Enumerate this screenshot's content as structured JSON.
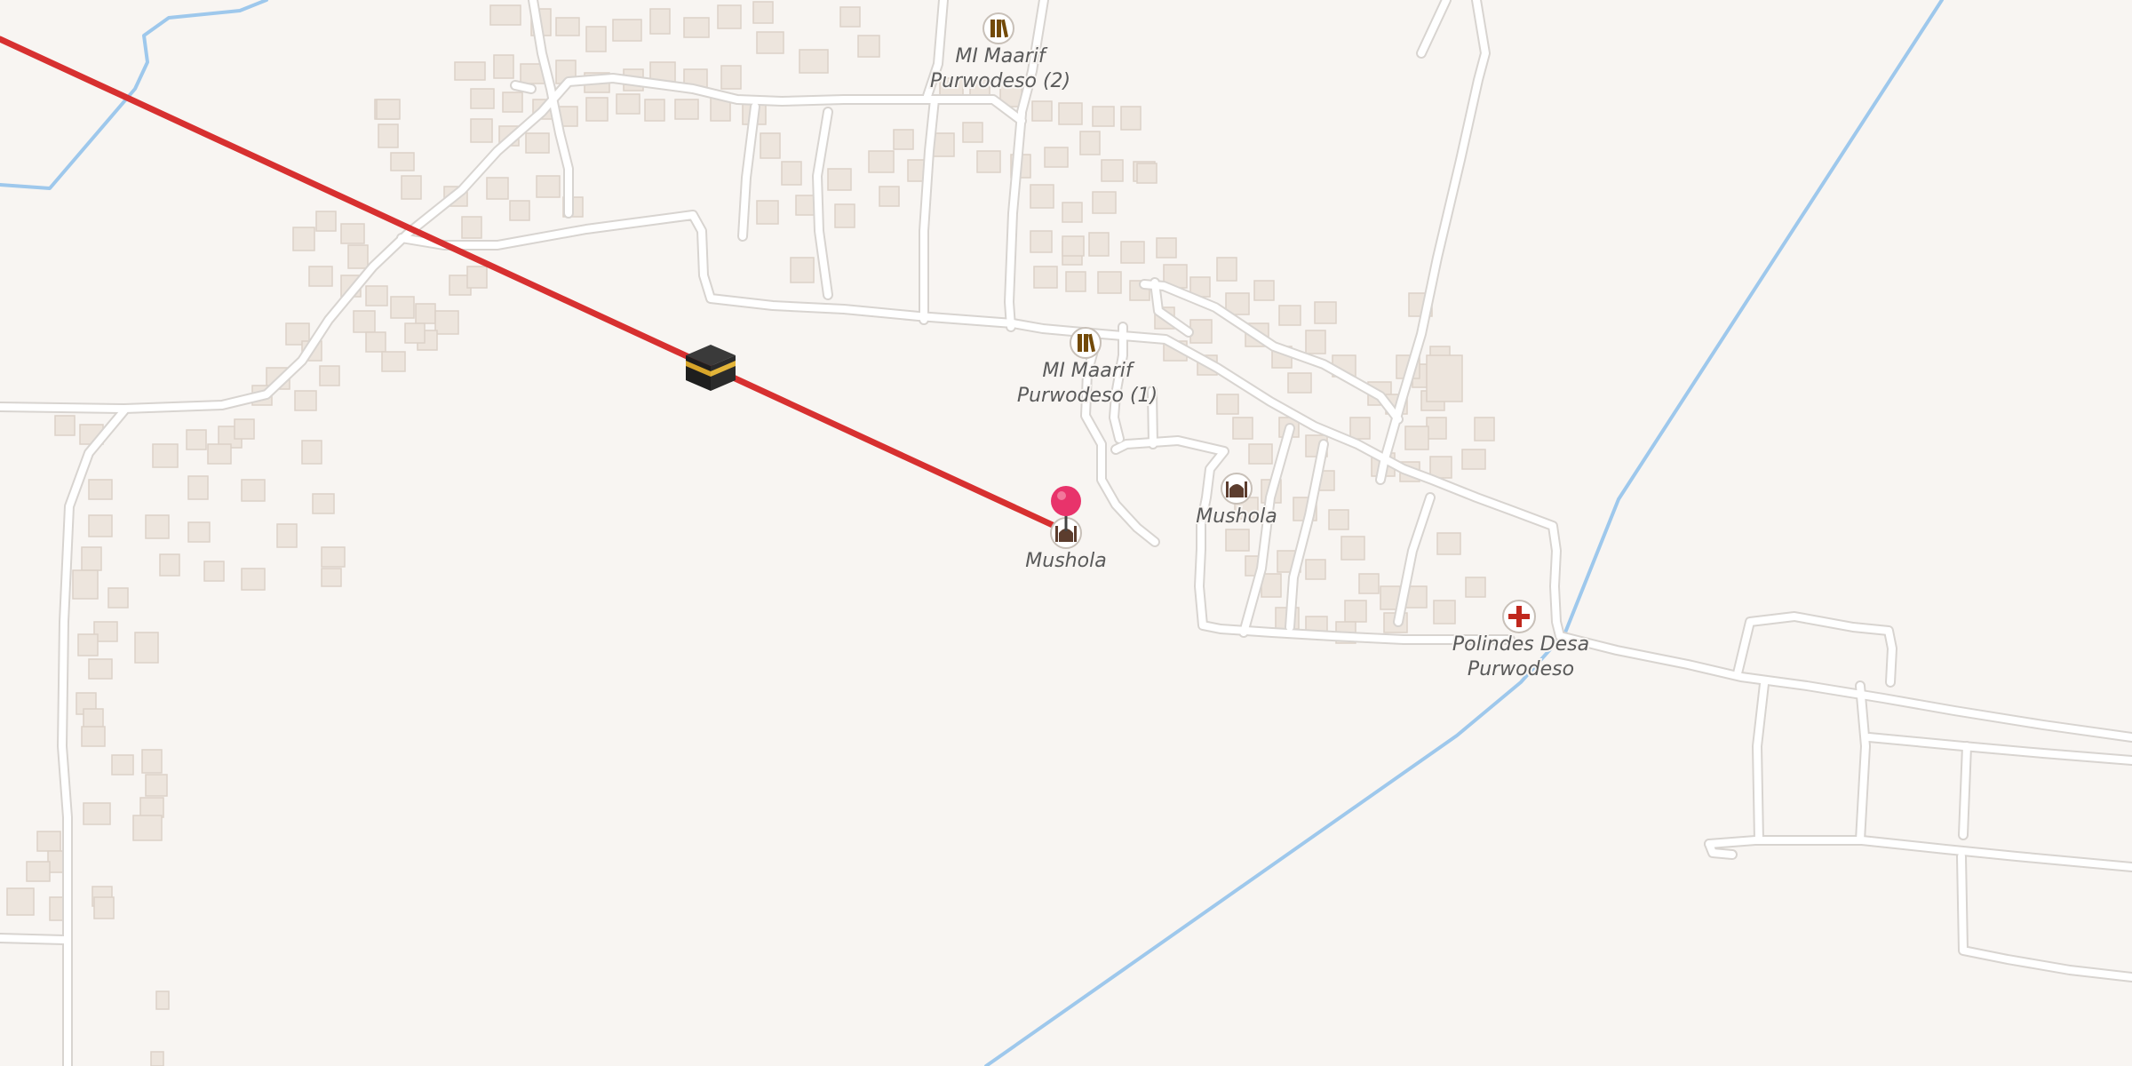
{
  "map": {
    "background_color": "#f8f5f2",
    "road_color": "#ffffff",
    "road_casing_color": "#d8d4d0",
    "building_color": "#ede5dd",
    "water_color": "#9ec8ec",
    "qibla_line_color": "#d73030",
    "pin_color": "#e8336b"
  },
  "pois": [
    {
      "id": "school-2",
      "icon": "school-icon",
      "label_lines": [
        "MI Maarif",
        "Purwodeso (2)"
      ]
    },
    {
      "id": "school-1",
      "icon": "school-icon",
      "label_lines": [
        "MI Maarif",
        "Purwodeso (1)"
      ]
    },
    {
      "id": "mushola-1",
      "icon": "mosque-icon",
      "label_lines": [
        "Mushola"
      ]
    },
    {
      "id": "mushola-2",
      "icon": "mosque-icon",
      "label_lines": [
        "Mushola"
      ]
    },
    {
      "id": "clinic",
      "icon": "health-cross-icon",
      "label_lines": [
        "Polindes Desa",
        "Purwodeso"
      ]
    }
  ],
  "markers": {
    "kaaba": {
      "icon": "kaaba-icon"
    },
    "location_pin": {
      "icon": "location-pin-icon"
    }
  }
}
